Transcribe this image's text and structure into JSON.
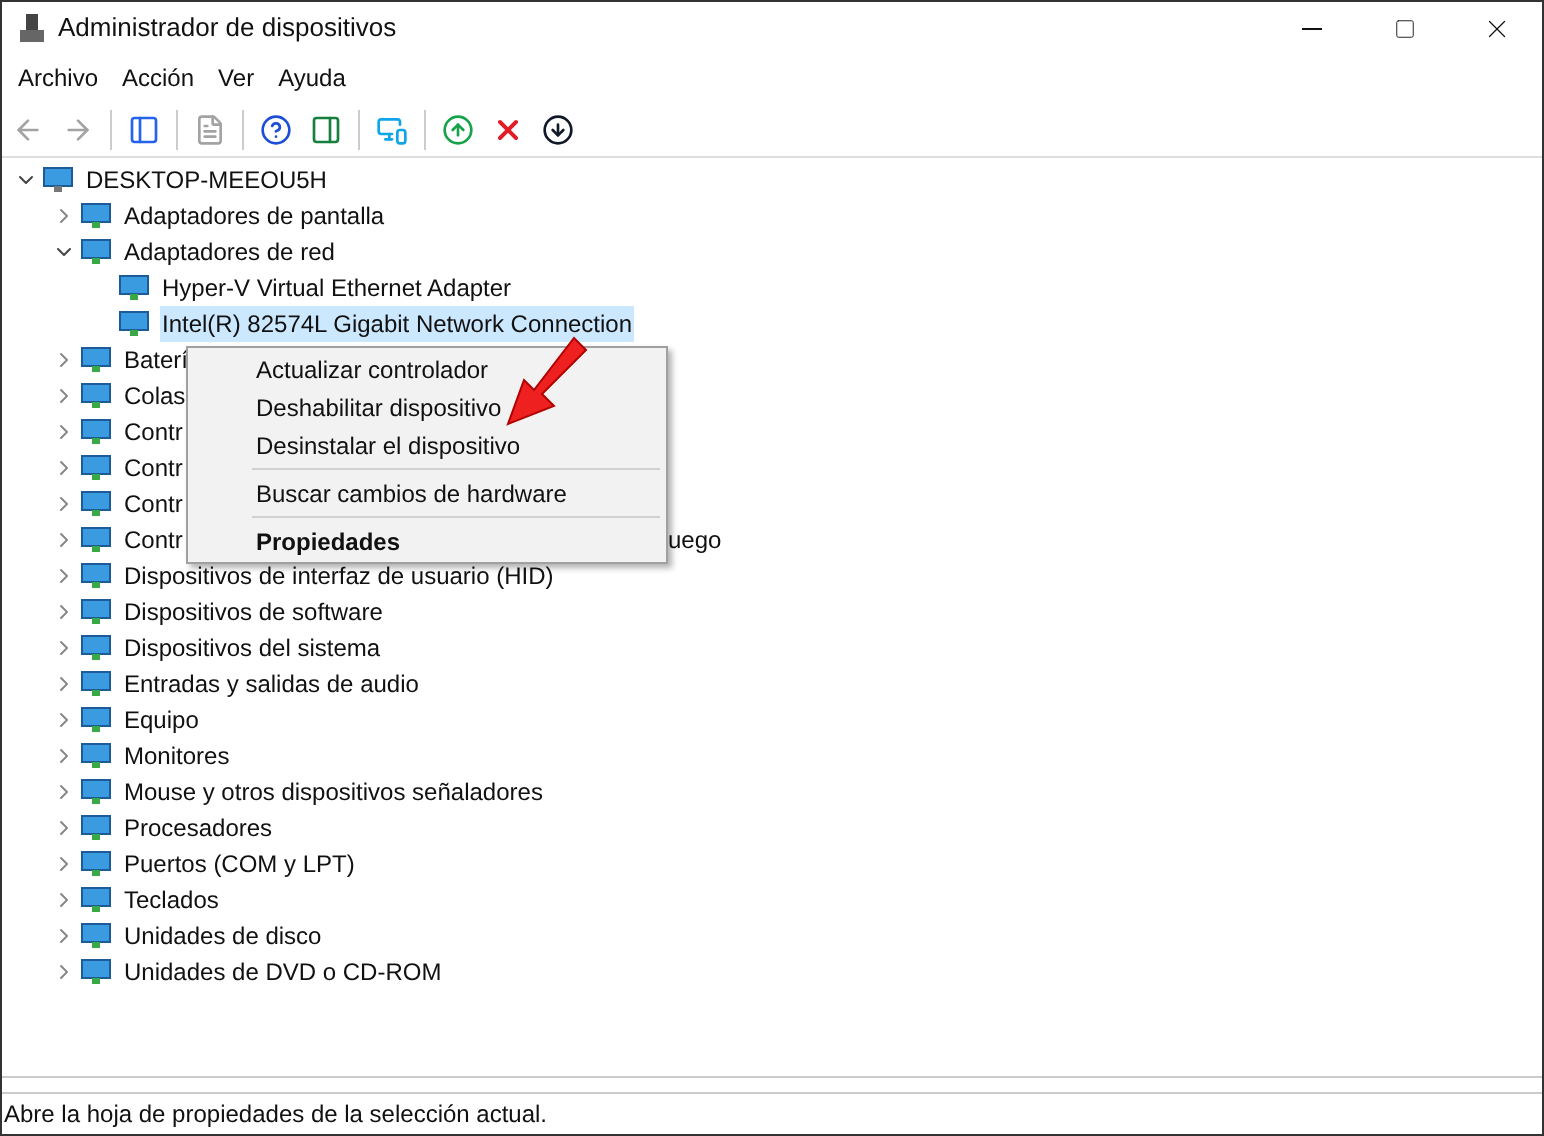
{
  "window": {
    "title": "Administrador de dispositivos"
  },
  "menu_bar": [
    "Archivo",
    "Acción",
    "Ver",
    "Ayuda"
  ],
  "toolbar": [
    {
      "kind": "back",
      "disabled": true
    },
    {
      "kind": "forward",
      "disabled": true
    },
    {
      "kind": "tree",
      "disabled": false
    },
    {
      "kind": "properties",
      "disabled": true
    },
    {
      "kind": "help",
      "disabled": false
    },
    {
      "kind": "pane",
      "disabled": false
    },
    {
      "kind": "scan",
      "disabled": false
    },
    {
      "kind": "update",
      "disabled": false
    },
    {
      "kind": "remove",
      "disabled": false
    },
    {
      "kind": "disable",
      "disabled": false
    }
  ],
  "tree": {
    "label": "DESKTOP-MEEOU5H",
    "expanded": true,
    "children": [
      {
        "label": "Adaptadores de pantalla",
        "expanded": false
      },
      {
        "label": "Adaptadores de red",
        "expanded": true,
        "children": [
          {
            "label": "Hyper-V Virtual Ethernet Adapter",
            "selected": false
          },
          {
            "label": "Intel(R) 82574L Gigabit Network Connection",
            "selected": true
          }
        ]
      },
      {
        "label": "Baterí",
        "expanded": false
      },
      {
        "label": "Colas",
        "expanded": false
      },
      {
        "label": "Contr",
        "expanded": false
      },
      {
        "label": "Contr",
        "expanded": false
      },
      {
        "label": "Contr",
        "expanded": false
      },
      {
        "label": "Contr",
        "label_tail": "uego",
        "expanded": false
      },
      {
        "label": "Dispositivos de interfaz de usuario (HID)",
        "expanded": false
      },
      {
        "label": "Dispositivos de software",
        "expanded": false
      },
      {
        "label": "Dispositivos del sistema",
        "expanded": false
      },
      {
        "label": "Entradas y salidas de audio",
        "expanded": false
      },
      {
        "label": "Equipo",
        "expanded": false
      },
      {
        "label": "Monitores",
        "expanded": false
      },
      {
        "label": "Mouse y otros dispositivos señaladores",
        "expanded": false
      },
      {
        "label": "Procesadores",
        "expanded": false
      },
      {
        "label": "Puertos (COM y LPT)",
        "expanded": false
      },
      {
        "label": "Teclados",
        "expanded": false
      },
      {
        "label": "Unidades de disco",
        "expanded": false
      },
      {
        "label": "Unidades de DVD o CD-ROM",
        "expanded": false
      }
    ]
  },
  "context_menu": [
    {
      "kind": "item",
      "label": "Actualizar controlador"
    },
    {
      "kind": "item",
      "label": "Deshabilitar dispositivo"
    },
    {
      "kind": "item",
      "label": "Desinstalar el dispositivo"
    },
    {
      "kind": "separator"
    },
    {
      "kind": "item",
      "label": "Buscar cambios de hardware"
    },
    {
      "kind": "separator"
    },
    {
      "kind": "default",
      "label": "Propiedades"
    }
  ],
  "status_bar": "Abre la hoja de propiedades de la selección actual."
}
